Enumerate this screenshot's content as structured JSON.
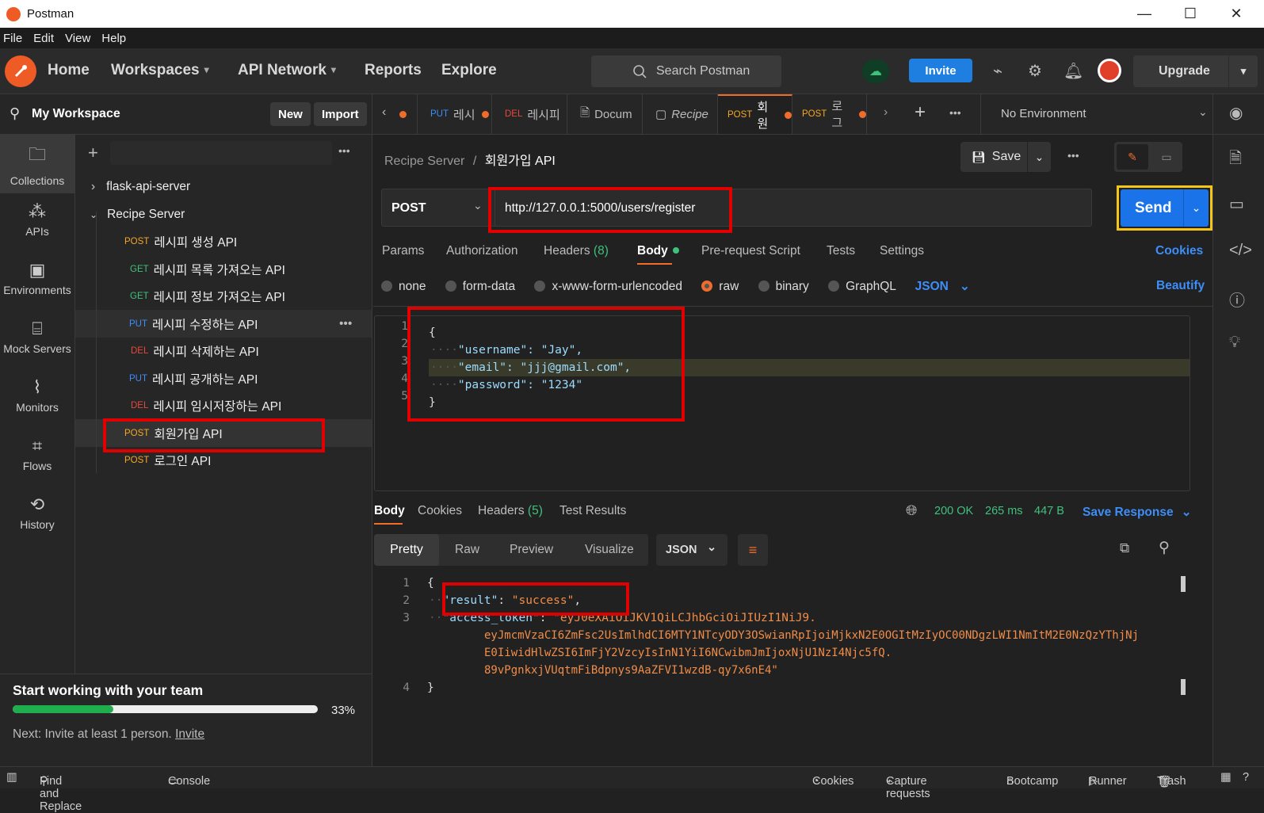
{
  "window": {
    "title": "Postman",
    "minimize": "—",
    "maximize": "☐",
    "close": "✕"
  },
  "menu": [
    "File",
    "Edit",
    "View",
    "Help"
  ],
  "header": {
    "nav": [
      "Home",
      "Workspaces",
      "API Network",
      "Reports",
      "Explore"
    ],
    "search_placeholder": "Search Postman",
    "invite": "Invite",
    "upgrade": "Upgrade"
  },
  "workspace": {
    "name": "My Workspace",
    "new": "New",
    "import": "Import"
  },
  "rail": [
    "Collections",
    "APIs",
    "Environments",
    "Mock Servers",
    "Monitors",
    "Flows",
    "History"
  ],
  "tree": {
    "collections": [
      {
        "name": "flask-api-server",
        "expanded": false
      },
      {
        "name": "Recipe Server",
        "expanded": true
      }
    ],
    "requests": [
      {
        "method": "POST",
        "name": "레시피 생성 API"
      },
      {
        "method": "GET",
        "name": "레시피 목록 가져오는 API"
      },
      {
        "method": "GET",
        "name": "레시피 정보 가져오는 API"
      },
      {
        "method": "PUT",
        "name": "레시피 수정하는 API"
      },
      {
        "method": "DEL",
        "name": "레시피 삭제하는 API"
      },
      {
        "method": "PUT",
        "name": "레시피 공개하는 API"
      },
      {
        "method": "DEL",
        "name": "레시피 임시저장하는 API"
      },
      {
        "method": "POST",
        "name": "회원가입 API"
      },
      {
        "method": "POST",
        "name": "로그인 API"
      }
    ]
  },
  "team": {
    "title": "Start working with your team",
    "progress_pct": 33,
    "progress_label": "33%",
    "next": "Next: Invite at least 1 person.",
    "invite_link": "Invite"
  },
  "tabs": [
    {
      "method": "PUT",
      "label": "레시"
    },
    {
      "method": "DEL",
      "label": "레시피"
    },
    {
      "method": "",
      "label": "Docum"
    },
    {
      "method": "",
      "label": "Recipe"
    },
    {
      "method": "POST",
      "label": "회원"
    },
    {
      "method": "POST",
      "label": "로그"
    }
  ],
  "environment": "No Environment",
  "breadcrumb": {
    "collection": "Recipe Server",
    "sep": "/",
    "request": "회원가입 API"
  },
  "request": {
    "save": "Save",
    "method": "POST",
    "url": "http://127.0.0.1:5000/users/register",
    "send": "Send"
  },
  "req_tabs": {
    "params": "Params",
    "authorization": "Authorization",
    "headers": "Headers",
    "headers_count": "(8)",
    "body": "Body",
    "prerequest": "Pre-request Script",
    "tests": "Tests",
    "settings": "Settings",
    "cookies": "Cookies"
  },
  "body_types": {
    "none": "none",
    "form_data": "form-data",
    "urlencoded": "x-www-form-urlencoded",
    "raw": "raw",
    "binary": "binary",
    "graphql": "GraphQL",
    "format": "JSON",
    "beautify": "Beautify"
  },
  "request_body": [
    "{",
    "\"username\": \"Jay\",",
    "\"email\": \"jjj@gmail.com\",",
    "\"password\": \"1234\"",
    "}"
  ],
  "response": {
    "tabs": {
      "body": "Body",
      "cookies": "Cookies",
      "headers": "Headers",
      "headers_count": "(5)",
      "tests": "Test Results"
    },
    "status": "200 OK",
    "time": "265 ms",
    "size": "447 B",
    "save": "Save Response",
    "views": [
      "Pretty",
      "Raw",
      "Preview",
      "Visualize"
    ],
    "format": "JSON",
    "result_key": "\"result\"",
    "result_val": "\"success\"",
    "token_key": "\"access_token\"",
    "token_lines": [
      "\"eyJ0eXAiOiJKV1QiLCJhbGciOiJIUzI1NiJ9.",
      "eyJmcmVzaCI6ZmFsc2UsImlhdCI6MTY1NTcyODY3OSwianRpIjoiMjkxN2E0OGItMzIyOC00NDgzLWI1NmItM2E0NzQzYThjNj",
      "E0IiwidHlwZSI6ImFjY2VzcyIsInN1YiI6NCwibmJmIjoxNjU1NzI4Njc5fQ.",
      "89vPgnkxjVUqtmFiBdpnys9AaZFVI1wzdB-qy7x6nE4\""
    ]
  },
  "status_bar": {
    "find": "Find and Replace",
    "console": "Console",
    "cookies": "Cookies",
    "capture": "Capture requests",
    "bootcamp": "Bootcamp",
    "runner": "Runner",
    "trash": "Trash"
  }
}
